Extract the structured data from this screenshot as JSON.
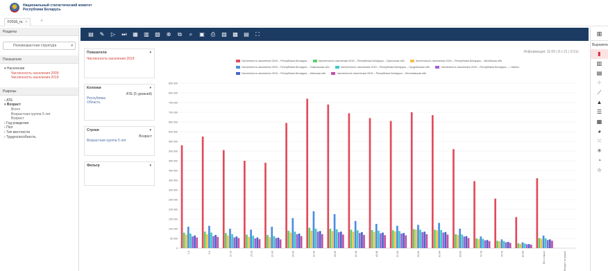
{
  "header": {
    "org_line1": "Национальный статистический комитет",
    "org_line2": "Республики Беларусь"
  },
  "tabs": [
    {
      "label": "F2016_ru",
      "close": "×"
    }
  ],
  "tab_add": "+",
  "left": {
    "sections_title": "Разделы",
    "section_select": "Половозрастная структура",
    "indicators_title": "Показатели",
    "indicators": {
      "group": "Население",
      "items": [
        "Численность населения 2009",
        "Численность населения 2019"
      ]
    },
    "dimensions_title": "Разрезы",
    "dimensions": [
      {
        "label": "АТЕ",
        "expanded": false
      },
      {
        "label": "Возраст",
        "expanded": true,
        "children": [
          "Всего",
          "Возрастная группа 5 лет",
          "Возраст"
        ]
      },
      {
        "label": "Год рождения",
        "expanded": false
      },
      {
        "label": "Пол",
        "expanded": false
      },
      {
        "label": "Тип местности",
        "expanded": false
      },
      {
        "label": "Трудоспособность",
        "expanded": false
      }
    ]
  },
  "toolbar": {
    "icons": [
      "table-icon",
      "pen-icon",
      "play-icon",
      "forward-icon",
      "grid-icon",
      "columns-icon",
      "export-icon",
      "link-icon",
      "chart-icon",
      "search-icon",
      "image-icon",
      "print-icon",
      "excel-icon",
      "pdf-icon",
      "doc-icon",
      "fullscreen-icon"
    ]
  },
  "panels": {
    "indicators": {
      "title": "Показатели",
      "value": "Численность населения 2019"
    },
    "columns": {
      "title": "Колонки",
      "right": "АТЕ (5 уровней)",
      "items": [
        "Республика",
        "Область"
      ]
    },
    "rows": {
      "title": "Строки",
      "right": "Возраст",
      "items": [
        "Возрастная группа 5 лет"
      ]
    },
    "filter": {
      "title": "Фильтр"
    }
  },
  "info": "Информация: 11:00 | 8 х 21 | 0.01с",
  "right_strip": {
    "header_icon": "grid-icon",
    "label": "Выражение",
    "icons": [
      "bar-chart-icon",
      "stacked-bar-icon",
      "column-icon",
      "scatter-icon",
      "line-icon",
      "area-icon",
      "horizontal-bar-icon",
      "table-icon",
      "donut-icon",
      "bubble-icon",
      "radar-icon",
      "pie-icon",
      "star-icon"
    ]
  },
  "colors": {
    "toolbar_bg": "#1c3b63",
    "accent_red": "#d0453a"
  },
  "chart_data": {
    "type": "bar",
    "categories": [
      "0-4",
      "5-9",
      "10-14",
      "15-19",
      "20-24",
      "25-29",
      "30-34",
      "35-39",
      "40-44",
      "45-49",
      "50-54",
      "55-59",
      "60-64",
      "65-69",
      "70-74",
      "75-79",
      "80-84",
      "85 и старше",
      "Возраст не указан"
    ],
    "series": [
      {
        "name": "Численность населения 2019 – Республика Беларусь",
        "color": "#e14b5a",
        "values": [
          530000,
          575000,
          505000,
          450000,
          440000,
          645000,
          770000,
          740000,
          695000,
          670000,
          655000,
          700000,
          685000,
          510000,
          345000,
          255000,
          160000,
          360000,
          0
        ]
      },
      {
        "name": "Численность населения 2019 – Республика Беларусь – Брестская обл",
        "color": "#5ed06a",
        "values": [
          80000,
          85000,
          78000,
          70000,
          68000,
          90000,
          105000,
          100000,
          95000,
          93000,
          92000,
          98000,
          95000,
          72000,
          50000,
          38000,
          25000,
          52000,
          0
        ]
      },
      {
        "name": "Численность населения 2019 – Республика Беларусь – Витебская обл",
        "color": "#f2c14a",
        "values": [
          70000,
          72000,
          65000,
          58000,
          56000,
          80000,
          90000,
          88000,
          85000,
          84000,
          86000,
          95000,
          92000,
          68000,
          46000,
          35000,
          22000,
          48000,
          0
        ]
      },
      {
        "name": "Численность населения 2019 – Республика Беларусь – Гомельская обл",
        "color": "#4a8fe0",
        "values": [
          110000,
          115000,
          100000,
          95000,
          110000,
          155000,
          190000,
          175000,
          140000,
          125000,
          115000,
          120000,
          130000,
          100000,
          60000,
          45000,
          30000,
          65000,
          0
        ]
      },
      {
        "name": "Численность населения 2019 – Республика Беларусь – Гродненская обл",
        "color": "#3fc7c7",
        "values": [
          75000,
          80000,
          72000,
          64000,
          62000,
          85000,
          100000,
          97000,
          92000,
          90000,
          88000,
          95000,
          93000,
          70000,
          48000,
          36000,
          24000,
          50000,
          0
        ]
      },
      {
        "name": "Численность населения 2019 – Республика Беларусь – г. Минск",
        "color": "#a25fd6",
        "values": [
          60000,
          62000,
          55000,
          50000,
          52000,
          72000,
          85000,
          82000,
          78000,
          76000,
          75000,
          82000,
          80000,
          60000,
          40000,
          30000,
          20000,
          42000,
          0
        ]
      },
      {
        "name": "Численность населения 2019 – Республика Беларусь – Минская обл",
        "color": "#4766c9",
        "values": [
          65000,
          68000,
          60000,
          55000,
          54000,
          75000,
          88000,
          85000,
          82000,
          80000,
          78000,
          85000,
          83000,
          62000,
          42000,
          32000,
          21000,
          45000,
          0
        ]
      },
      {
        "name": "Численность населения 2019 – Республика Беларусь – Могилевская обл",
        "color": "#c64fa6",
        "values": [
          55000,
          58000,
          52000,
          46000,
          45000,
          62000,
          72000,
          70000,
          68000,
          67000,
          66000,
          72000,
          70000,
          52000,
          36000,
          27000,
          18000,
          38000,
          0
        ]
      }
    ],
    "ylim": [
      0,
      850000
    ],
    "yticks": [
      "850 000",
      "800 000",
      "750 000",
      "700 000",
      "650 000",
      "600 000",
      "550 000",
      "500 000",
      "450 000",
      "400 000",
      "350 000",
      "300 000",
      "250 000",
      "200 000",
      "150 000",
      "100 000",
      "50 000",
      "0"
    ],
    "grid": true,
    "legend_position": "top"
  }
}
